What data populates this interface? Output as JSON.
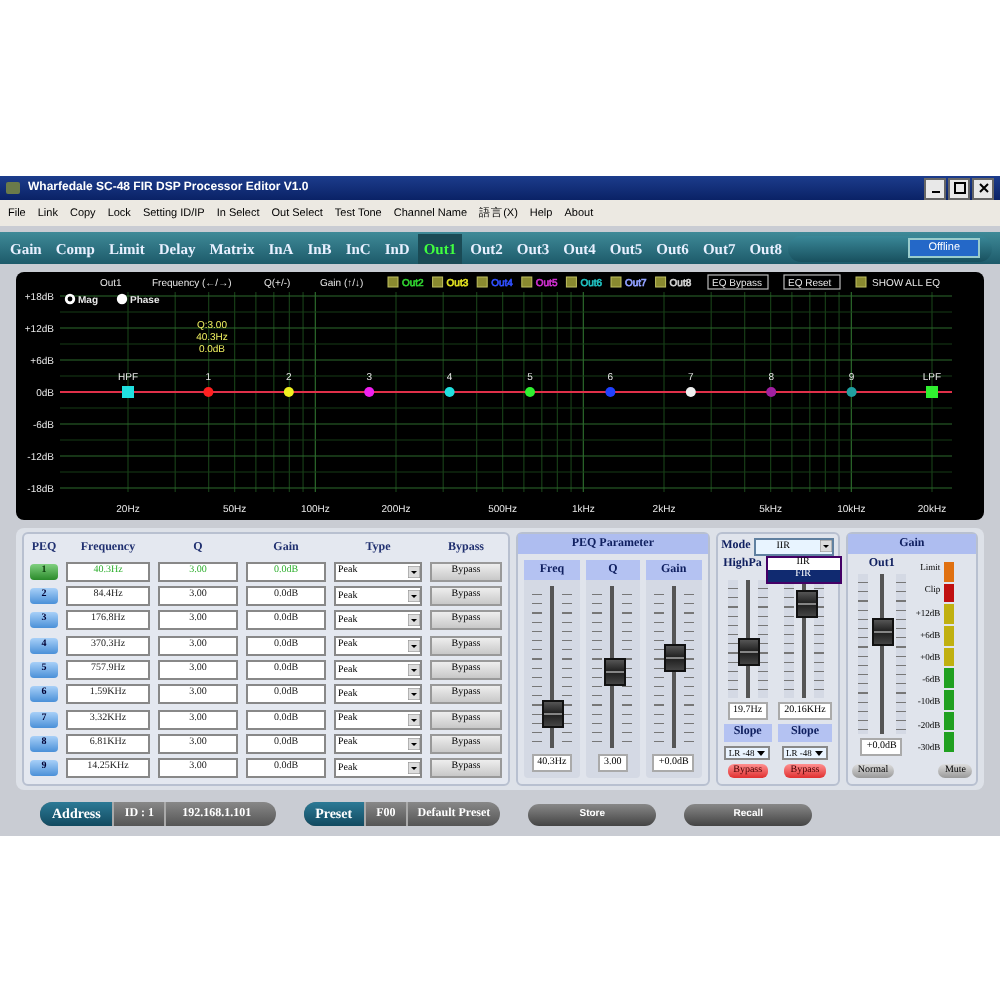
{
  "window": {
    "title": "Wharfedale SC-48 FIR DSP Processor Editor V1.0"
  },
  "menu": [
    "File",
    "Link",
    "Copy",
    "Lock",
    "Setting ID/IP",
    "In Select",
    "Out Select",
    "Test Tone",
    "Channel Name",
    "語言(X)",
    "Help",
    "About"
  ],
  "tabs": [
    {
      "label": "Gain",
      "selected": false
    },
    {
      "label": "Comp",
      "selected": false
    },
    {
      "label": "Limit",
      "selected": false
    },
    {
      "label": "Delay",
      "selected": false
    },
    {
      "label": "Matrix",
      "selected": false
    },
    {
      "label": "InA",
      "selected": false
    },
    {
      "label": "InB",
      "selected": false
    },
    {
      "label": "InC",
      "selected": false
    },
    {
      "label": "InD",
      "selected": false
    },
    {
      "label": "Out1",
      "selected": true
    },
    {
      "label": "Out2",
      "selected": false
    },
    {
      "label": "Out3",
      "selected": false
    },
    {
      "label": "Out4",
      "selected": false
    },
    {
      "label": "Out5",
      "selected": false
    },
    {
      "label": "Out6",
      "selected": false
    },
    {
      "label": "Out7",
      "selected": false
    },
    {
      "label": "Out8",
      "selected": false
    }
  ],
  "status": "Offline",
  "graph": {
    "channel": "Out1",
    "hints": [
      "Frequency (←/→)",
      "Q(+/-)",
      "Gain (↑/↓)"
    ],
    "overlays": [
      {
        "label": "Out2",
        "color": "#30d030",
        "checked": false
      },
      {
        "label": "Out3",
        "color": "#e0e020",
        "checked": false
      },
      {
        "label": "Out4",
        "color": "#3050ff",
        "checked": false
      },
      {
        "label": "Out5",
        "color": "#d030d0",
        "checked": false
      },
      {
        "label": "Out6",
        "color": "#20c0c0",
        "checked": false
      },
      {
        "label": "Out7",
        "color": "#90a0ff",
        "checked": false
      },
      {
        "label": "Out8",
        "color": "#d0d0d0",
        "checked": false
      }
    ],
    "buttons": [
      "EQ Bypass",
      "EQ Reset"
    ],
    "show_all": {
      "label": "SHOW ALL EQ",
      "checked": false
    },
    "views": [
      {
        "label": "Mag",
        "selected": true
      },
      {
        "label": "Phase",
        "selected": false
      }
    ],
    "y_labels": [
      "+18dB",
      "+12dB",
      "+6dB",
      "0dB",
      "-6dB",
      "-12dB",
      "-18dB"
    ],
    "x_labels": [
      "20Hz",
      "50Hz",
      "100Hz",
      "200Hz",
      "500Hz",
      "1kHz",
      "2kHz",
      "5kHz",
      "10kHz",
      "20kHz"
    ],
    "readout": [
      "Q:3.00",
      "40.3Hz",
      "0.0dB"
    ],
    "points": [
      {
        "label": "HPF",
        "kind": "filter",
        "color": "#20e0e0"
      },
      {
        "label": "1",
        "kind": "band",
        "color": "#ff2020"
      },
      {
        "label": "2",
        "kind": "band",
        "color": "#f0f020"
      },
      {
        "label": "3",
        "kind": "band",
        "color": "#f020f0"
      },
      {
        "label": "4",
        "kind": "band",
        "color": "#20e0e0"
      },
      {
        "label": "5",
        "kind": "band",
        "color": "#30f030"
      },
      {
        "label": "6",
        "kind": "band",
        "color": "#2040ff"
      },
      {
        "label": "7",
        "kind": "band",
        "color": "#f0f0f0"
      },
      {
        "label": "8",
        "kind": "band",
        "color": "#a020a0"
      },
      {
        "label": "9",
        "kind": "band",
        "color": "#20a0a0"
      },
      {
        "label": "LPF",
        "kind": "filter",
        "color": "#30f030"
      }
    ]
  },
  "peq": {
    "headers": [
      "PEQ",
      "Frequency",
      "Q",
      "Gain",
      "Type",
      "Bypass"
    ],
    "rows": [
      {
        "index": "1",
        "frequency": "40.3Hz",
        "q": "3.00",
        "gain": "0.0dB",
        "type": "Peak",
        "bypass": "Bypass",
        "selected": true
      },
      {
        "index": "2",
        "frequency": "84.4Hz",
        "q": "3.00",
        "gain": "0.0dB",
        "type": "Peak",
        "bypass": "Bypass",
        "selected": false
      },
      {
        "index": "3",
        "frequency": "176.8Hz",
        "q": "3.00",
        "gain": "0.0dB",
        "type": "Peak",
        "bypass": "Bypass",
        "selected": false
      },
      {
        "index": "4",
        "frequency": "370.3Hz",
        "q": "3.00",
        "gain": "0.0dB",
        "type": "Peak",
        "bypass": "Bypass",
        "selected": false
      },
      {
        "index": "5",
        "frequency": "757.9Hz",
        "q": "3.00",
        "gain": "0.0dB",
        "type": "Peak",
        "bypass": "Bypass",
        "selected": false
      },
      {
        "index": "6",
        "frequency": "1.59KHz",
        "q": "3.00",
        "gain": "0.0dB",
        "type": "Peak",
        "bypass": "Bypass",
        "selected": false
      },
      {
        "index": "7",
        "frequency": "3.32KHz",
        "q": "3.00",
        "gain": "0.0dB",
        "type": "Peak",
        "bypass": "Bypass",
        "selected": false
      },
      {
        "index": "8",
        "frequency": "6.81KHz",
        "q": "3.00",
        "gain": "0.0dB",
        "type": "Peak",
        "bypass": "Bypass",
        "selected": false
      },
      {
        "index": "9",
        "frequency": "14.25KHz",
        "q": "3.00",
        "gain": "0.0dB",
        "type": "Peak",
        "bypass": "Bypass",
        "selected": false
      }
    ]
  },
  "peq_parameter": {
    "title": "PEQ Parameter",
    "sliders": [
      {
        "label": "Freq",
        "value": "40.3Hz",
        "level": 0.15
      },
      {
        "label": "Q",
        "value": "3.00",
        "level": 0.45
      },
      {
        "label": "Gain",
        "value": "+0.0dB",
        "level": 0.55
      }
    ]
  },
  "crossover": {
    "mode_label": "Mode",
    "mode": "IIR",
    "mode_options": [
      {
        "label": "IIR",
        "selected": false
      },
      {
        "label": "FIR",
        "selected": true
      }
    ],
    "title": "HighPa",
    "filters": [
      {
        "value": "19.7Hz",
        "level": 0.35,
        "slope_label": "Slope",
        "slope": "LR -48",
        "bypass": "Bypass"
      },
      {
        "value": "20.16KHz",
        "level": 0.85,
        "slope_label": "Slope",
        "slope": "LR -48",
        "bypass": "Bypass"
      }
    ]
  },
  "gain": {
    "title": "Gain",
    "channel": "Out1",
    "value": "+0.0dB",
    "level": 0.65,
    "meter_labels": [
      "Limit",
      "Clip",
      "+12dB",
      "+6dB",
      "+0dB",
      "-6dB",
      "-10dB",
      "-20dB",
      "-30dB"
    ],
    "buttons": [
      "Normal",
      "Mute"
    ]
  },
  "bottom": {
    "address_label": "Address",
    "id": "ID : 1",
    "ip": "192.168.1.101",
    "preset_label": "Preset",
    "preset_number": "F00",
    "preset_name": "Default Preset",
    "actions": [
      "Store",
      "Recall"
    ]
  }
}
